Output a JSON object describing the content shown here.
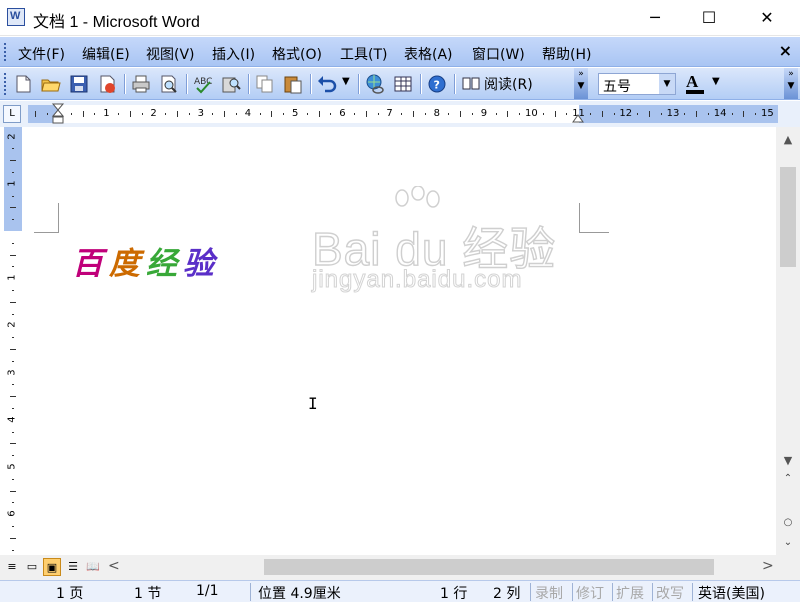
{
  "window": {
    "title": "文档 1 - Microsoft Word",
    "minimize_glyph": "─",
    "maximize_glyph": "☐",
    "close_glyph": "✕"
  },
  "menu": {
    "items": [
      "文件(F)",
      "编辑(E)",
      "视图(V)",
      "插入(I)",
      "格式(O)",
      "工具(T)",
      "表格(A)",
      "窗口(W)",
      "帮助(H)"
    ],
    "close_glyph": "×"
  },
  "toolbar": {
    "buttons": [
      "new-icon",
      "open-icon",
      "save-icon",
      "permission-icon",
      "print-icon",
      "print-preview-icon",
      "spelling-icon",
      "research-icon",
      "copy-icon",
      "paste-icon",
      "undo-icon",
      "hyperlink-icon",
      "table-icon",
      "help-icon",
      "read-icon"
    ],
    "read_label": "阅读(R)",
    "font_size": "五号",
    "font_color_letter": "A",
    "dropdown_glyph": "▼",
    "chevron_glyph": "»"
  },
  "ruler": {
    "tab_selector": "L",
    "numbers": [
      "2",
      "1",
      "1",
      "2",
      "3",
      "4",
      "5",
      "6",
      "7",
      "8",
      "9",
      "10",
      "11",
      "12",
      "13",
      "14",
      "15"
    ],
    "vertical_numbers": [
      "2",
      "1",
      "1",
      "2",
      "3",
      "4",
      "5",
      "6"
    ]
  },
  "document": {
    "art_text": [
      "百",
      "度",
      "经",
      "验"
    ],
    "art_colors": [
      "#c0007a",
      "#cc6a00",
      "#38a838",
      "#5a2fc8"
    ],
    "watermark_brand": "Bai du 经验",
    "watermark_url": "jingyan.baidu.com",
    "cursor_glyph": "I"
  },
  "scroll": {
    "up": "▲",
    "down": "▼",
    "left": "<",
    "right": ">",
    "prev_page": "⌃",
    "select_browse": "○",
    "next_page": "⌄"
  },
  "views": [
    "≡",
    "▭",
    "▣",
    "☰",
    "📖"
  ],
  "status": {
    "page": "1 页",
    "section": "1 节",
    "pages": "1/1",
    "position": "位置 4.9厘米",
    "line": "1 行",
    "column": "2 列",
    "rec": "录制",
    "trk": "修订",
    "ext": "扩展",
    "ovr": "改写",
    "language": "英语(美国)"
  }
}
